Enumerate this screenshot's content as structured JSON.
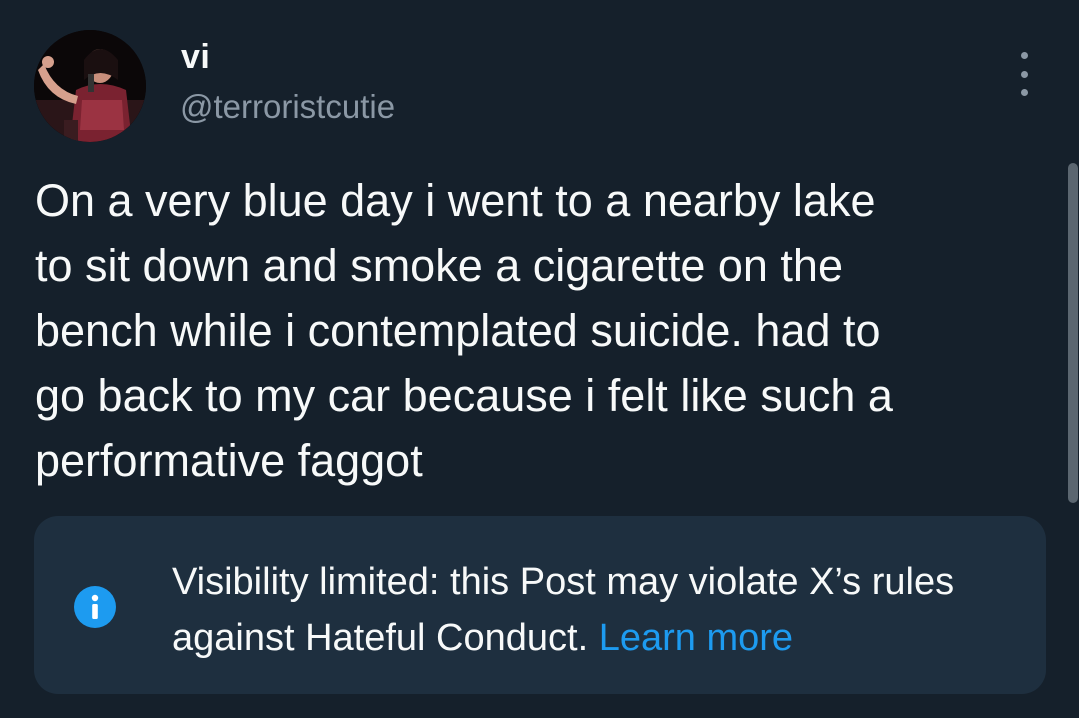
{
  "author": {
    "display_name": "vi",
    "handle": "@terroristcutie"
  },
  "post": {
    "text": "On a very blue day i went to a nearby lake\nto sit down and smoke a cigarette on the\nbench while i contemplated suicide. had to\ngo back to my car because i felt like such a\nperformative faggot"
  },
  "notice": {
    "icon": "info-icon",
    "text": "Visibility limited: this Post may violate X’s rules against Hateful Conduct.",
    "link_label": "Learn more"
  },
  "icons": {
    "more": "more-options-icon",
    "info": "info-icon"
  },
  "colors": {
    "background": "#15202b",
    "notice_background": "#1e2f3f",
    "accent": "#1d9bf0",
    "secondary_text": "#8b98a5",
    "primary_text": "#f7f9f9"
  }
}
